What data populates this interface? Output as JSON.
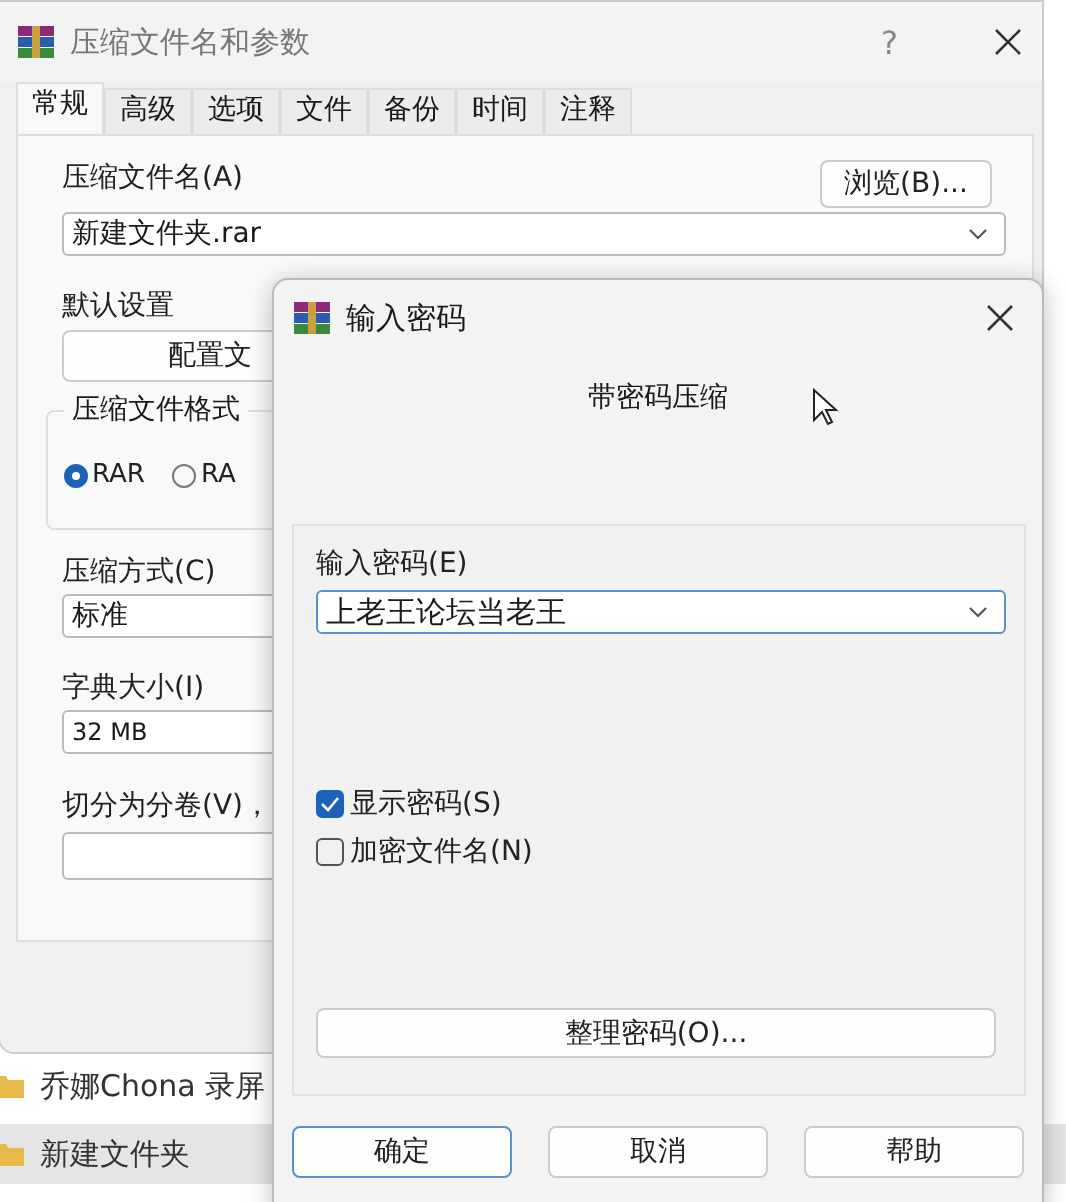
{
  "main_dialog": {
    "title": "压缩文件名和参数",
    "help": "?",
    "tabs": [
      {
        "label": "常规",
        "selected": true
      },
      {
        "label": "高级",
        "selected": false
      },
      {
        "label": "选项",
        "selected": false
      },
      {
        "label": "文件",
        "selected": false
      },
      {
        "label": "备份",
        "selected": false
      },
      {
        "label": "时间",
        "selected": false
      },
      {
        "label": "注释",
        "selected": false
      }
    ],
    "archive_name_label": "压缩文件名(A)",
    "browse_button": "浏览(B)...",
    "archive_name": "新建文件夹.rar",
    "default_settings_label": "默认设置",
    "profiles_button": "配置文",
    "format_group": {
      "title": "压缩文件格式",
      "options": [
        {
          "label": "RAR",
          "selected": true
        },
        {
          "label": "RA",
          "selected": false
        }
      ]
    },
    "method_label": "压缩方式(C)",
    "method": "标准",
    "dictionary_label": "字典大小(I)",
    "dictionary": "32 MB",
    "split_label": "切分为分卷(V)，"
  },
  "explorer_items": [
    {
      "name": "乔娜Chona 录屏",
      "selected": false
    },
    {
      "name": "新建文件夹",
      "selected": true
    }
  ],
  "password_dialog": {
    "title": "输入密码",
    "heading": "带密码压缩",
    "password_label": "输入密码(E)",
    "password": "上老王论坛当老王",
    "options": [
      {
        "label": "显示密码(S)",
        "checked": true
      },
      {
        "label": "加密文件名(N)",
        "checked": false
      }
    ],
    "organize_button": "整理密码(O)...",
    "buttons": [
      {
        "label": "确定",
        "default": true
      },
      {
        "label": "取消",
        "default": false
      },
      {
        "label": "帮助",
        "default": false
      }
    ]
  }
}
